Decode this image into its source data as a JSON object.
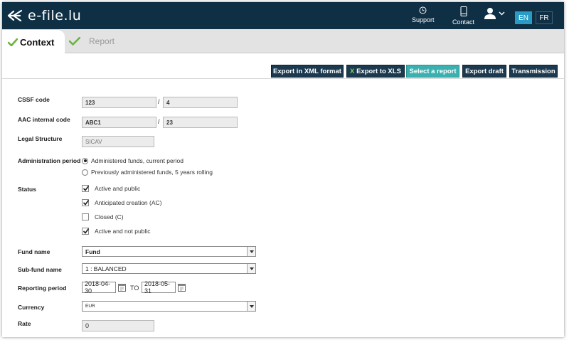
{
  "header": {
    "logo_text": "e-file.lu",
    "nav": [
      {
        "label": "Support",
        "icon": "clock-icon"
      },
      {
        "label": "Contact",
        "icon": "phone-icon"
      }
    ],
    "languages": [
      "EN",
      "FR"
    ]
  },
  "tabs": [
    {
      "label": "Context",
      "state": "active"
    },
    {
      "label": "Report",
      "state": "inactive"
    }
  ],
  "toolbar": {
    "export_xml": "Export in XML format",
    "export_xls": "Export to XLS",
    "select_report": "Select a report",
    "export_draft": "Export draft",
    "transmission": "Transmission"
  },
  "form": {
    "cssf_code": {
      "label": "CSSF code",
      "value1": "123",
      "separator": "/",
      "value2": "4"
    },
    "aac_code": {
      "label": "AAC internal code",
      "value1": "ABC1",
      "separator": "/",
      "value2": "23"
    },
    "legal_structure": {
      "label": "Legal Structure",
      "value": "SICAV"
    },
    "admin_period": {
      "label": "Administration period",
      "options": [
        "Administered funds, current period",
        "Previously administered funds, 5 years rolling"
      ],
      "selected_index": 0
    },
    "status": {
      "label": "Status",
      "options": [
        {
          "label": "Active and public",
          "checked": true
        },
        {
          "label": "Anticipated creation (AC)",
          "checked": true
        },
        {
          "label": "Closed (C)",
          "checked": false
        },
        {
          "label": "Active and not public",
          "checked": true
        }
      ]
    },
    "fund_name": {
      "label": "Fund name",
      "value": "Fund"
    },
    "sub_fund_name": {
      "label": "Sub-fund name",
      "value": "1 : BALANCED"
    },
    "reporting_period": {
      "label": "Reporting period",
      "from": "2018-04-30",
      "to_label": "TO",
      "to": "2018-05-31"
    },
    "currency": {
      "label": "Currency",
      "value": "EUR"
    },
    "rate": {
      "label": "Rate",
      "value": "0"
    }
  },
  "colors": {
    "header_bg": "#0f2f45",
    "accent": "#3ab1b0",
    "lang_active": "#2a9bc4",
    "check_green": "#6cb33f"
  }
}
